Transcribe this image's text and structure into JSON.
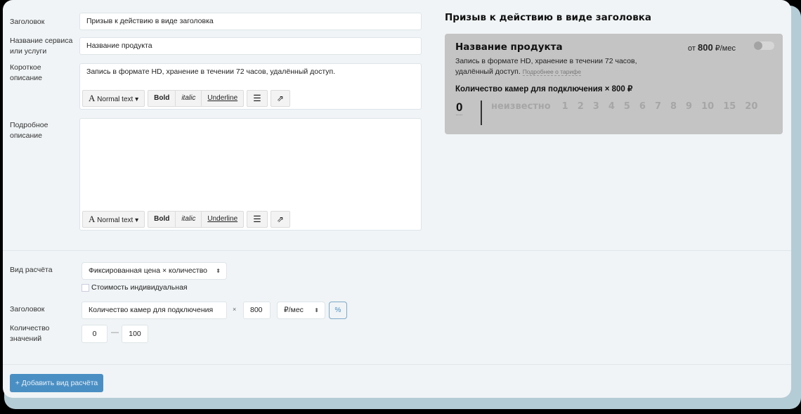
{
  "form": {
    "title_label": "Заголовок",
    "title_value": "Призыв к действию в виде заголовка",
    "name_label": "Название сервиса или услуги",
    "name_value": "Название продукта",
    "short_label": "Короткое описание",
    "short_value": "Запись в формате HD, хранение в течении 72 часов, удалённый доступ.",
    "long_label": "Подробное описание",
    "long_value": "",
    "toolbar": {
      "style": "Normal text",
      "bold": "Bold",
      "italic": "italic",
      "underline": "Underline"
    }
  },
  "calc": {
    "type_label": "Вид расчёта",
    "type_value": "Фиксированная цена × количество",
    "individual_label": "Стоимость индивидуальная",
    "individual_checked": false,
    "header_label": "Заголовок",
    "header_value": "Количество камер для подключения",
    "times": "×",
    "price": "800",
    "unit": "₽/мес",
    "percent": "%",
    "count_label": "Количество значений",
    "min": "0",
    "dash": "—",
    "max": "100",
    "add_button": "+ Добавить вид расчёта"
  },
  "preview": {
    "heading": "Призыв к действию в виде заголовка",
    "product": "Название продукта",
    "price_prefix": "от",
    "price": "800",
    "price_unit": "₽/мес",
    "desc": "Запись в формате HD, хранение в течении 72 часов, удалённый доступ.",
    "more_link": "Подробнее о тарифе",
    "qty_title": "Количество камер для подключения × 800 ₽",
    "current": "0",
    "options": [
      "неизвестно",
      "1",
      "2",
      "3",
      "4",
      "5",
      "6",
      "7",
      "8",
      "9",
      "10",
      "15",
      "20"
    ],
    "toggle_on": false
  },
  "colors": {
    "accent": "#4a8fc4",
    "card": "#c4c4c4"
  }
}
